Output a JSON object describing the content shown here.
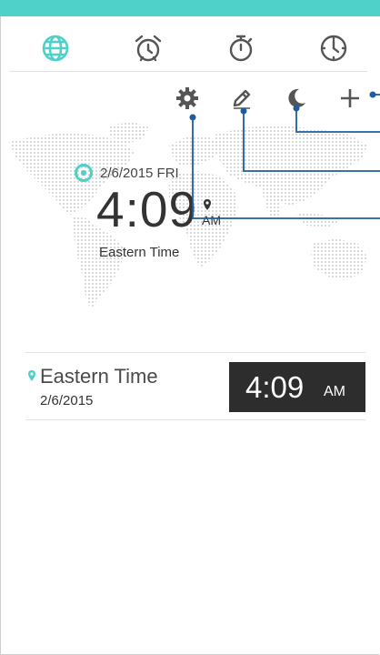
{
  "colors": {
    "accent": "#4fd0c8",
    "callout": "#1e5ea0",
    "dark_panel": "#2d2d2d",
    "icon": "#555555"
  },
  "tabs": [
    {
      "name": "world-clock",
      "icon": "globe-icon",
      "active": true
    },
    {
      "name": "alarm",
      "icon": "alarm-clock-icon",
      "active": false
    },
    {
      "name": "stopwatch",
      "icon": "stopwatch-icon",
      "active": false
    },
    {
      "name": "timer",
      "icon": "timer-icon",
      "active": false
    }
  ],
  "actions": [
    {
      "name": "settings",
      "icon": "gear-icon"
    },
    {
      "name": "edit",
      "icon": "pencil-icon"
    },
    {
      "name": "night-mode",
      "icon": "moon-icon"
    },
    {
      "name": "add-city",
      "icon": "plus-icon"
    }
  ],
  "clock": {
    "date": "2/6/2015 FRI",
    "time": "4:09",
    "ampm": "AM",
    "zone": "Eastern Time"
  },
  "cities": [
    {
      "name": "Eastern Time",
      "date": "2/6/2015",
      "time": "4:09",
      "ampm": "AM"
    }
  ]
}
